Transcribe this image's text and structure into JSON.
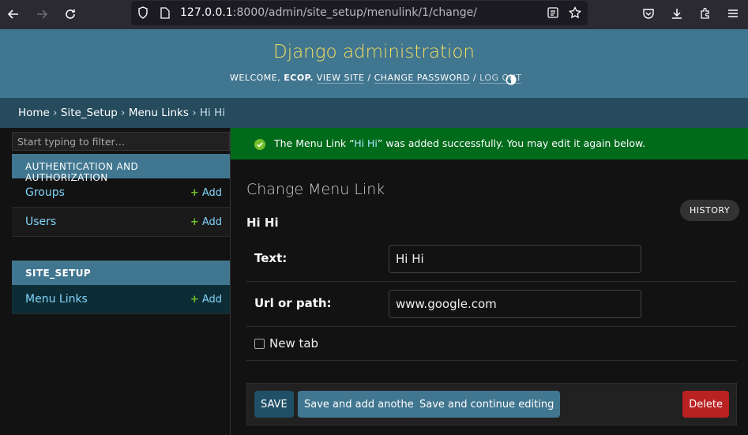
{
  "browser": {
    "url_host": "127.0.0.1",
    "url_rest": ":8000/admin/site_setup/menulink/1/change/"
  },
  "header": {
    "site_name": "Django administration",
    "welcome": "WELCOME,",
    "username": "ECOP.",
    "view_site": "VIEW SITE",
    "change_password": "CHANGE PASSWORD",
    "log_out": "LOG OUT",
    "separator": "/"
  },
  "breadcrumbs": [
    "Home",
    "Site_Setup",
    "Menu Links",
    "Hi Hi"
  ],
  "breadcrumb_sep": "›",
  "sidebar": {
    "filter_placeholder": "Start typing to filter…",
    "modules": [
      {
        "caption": "AUTHENTICATION AND AUTHORIZATION",
        "models": [
          {
            "name": "Groups",
            "add": "Add"
          },
          {
            "name": "Users",
            "add": "Add"
          }
        ]
      },
      {
        "caption": "SITE_SETUP",
        "models": [
          {
            "name": "Menu Links",
            "add": "Add"
          }
        ]
      }
    ]
  },
  "message": {
    "prefix": "The Menu Link “",
    "link": "Hi Hi",
    "suffix": "” was added successfully. You may edit it again below."
  },
  "main": {
    "page_title": "Change Menu Link",
    "history_label": "HISTORY",
    "object_title": "Hi Hi",
    "fields": {
      "text_label": "Text:",
      "text_value": "Hi Hi",
      "url_label": "Url or path:",
      "url_value": "www.google.com",
      "new_tab_label": "New tab"
    }
  },
  "submit": {
    "save": "SAVE",
    "save_add_another": "Save and add another",
    "save_continue": "Save and continue editing",
    "delete": "Delete"
  },
  "colors": {
    "header": "#417690",
    "breadcrumbs": "#264b5d",
    "success": "#006b1b",
    "delete": "#ba2121",
    "site_name": "#f5dd5d"
  }
}
